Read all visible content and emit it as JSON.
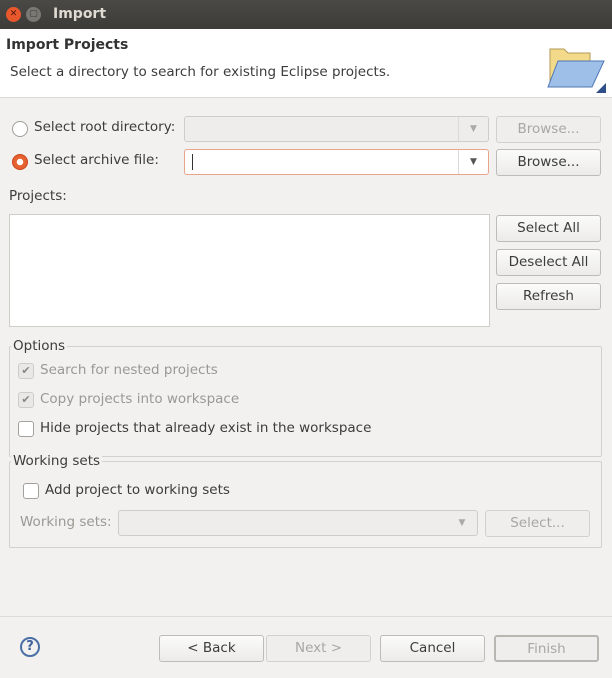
{
  "window": {
    "title": "Import",
    "close_icon": "close-icon",
    "maximize_icon": "maximize-icon"
  },
  "header": {
    "title": "Import Projects",
    "description": "Select a directory to search for existing Eclipse projects.",
    "icon": "folder-open-icon"
  },
  "source": {
    "root_directory": {
      "label": "Select root directory:",
      "selected": false,
      "value": "",
      "browse_label": "Browse...",
      "enabled": false
    },
    "archive_file": {
      "label": "Select archive file:",
      "selected": true,
      "value": "",
      "browse_label": "Browse...",
      "enabled": true
    }
  },
  "projects": {
    "label": "Projects:",
    "items": [],
    "select_all": "Select All",
    "deselect_all": "Deselect All",
    "refresh": "Refresh"
  },
  "options": {
    "title": "Options",
    "items": [
      {
        "label": "Search for nested projects",
        "checked": true,
        "enabled": false
      },
      {
        "label": "Copy projects into workspace",
        "checked": true,
        "enabled": false
      },
      {
        "label": "Hide projects that already exist in the workspace",
        "checked": false,
        "enabled": true
      }
    ]
  },
  "working_sets": {
    "title": "Working sets",
    "add_label": "Add project to working sets",
    "add_checked": false,
    "field_label": "Working sets:",
    "value": "",
    "select_label": "Select..."
  },
  "footer": {
    "help_icon": "help-icon",
    "help_glyph": "?",
    "back": "< Back",
    "next": "Next >",
    "cancel": "Cancel",
    "finish": "Finish"
  },
  "colors": {
    "accent": "#e7602f",
    "titlebar": "#3c3b37"
  }
}
